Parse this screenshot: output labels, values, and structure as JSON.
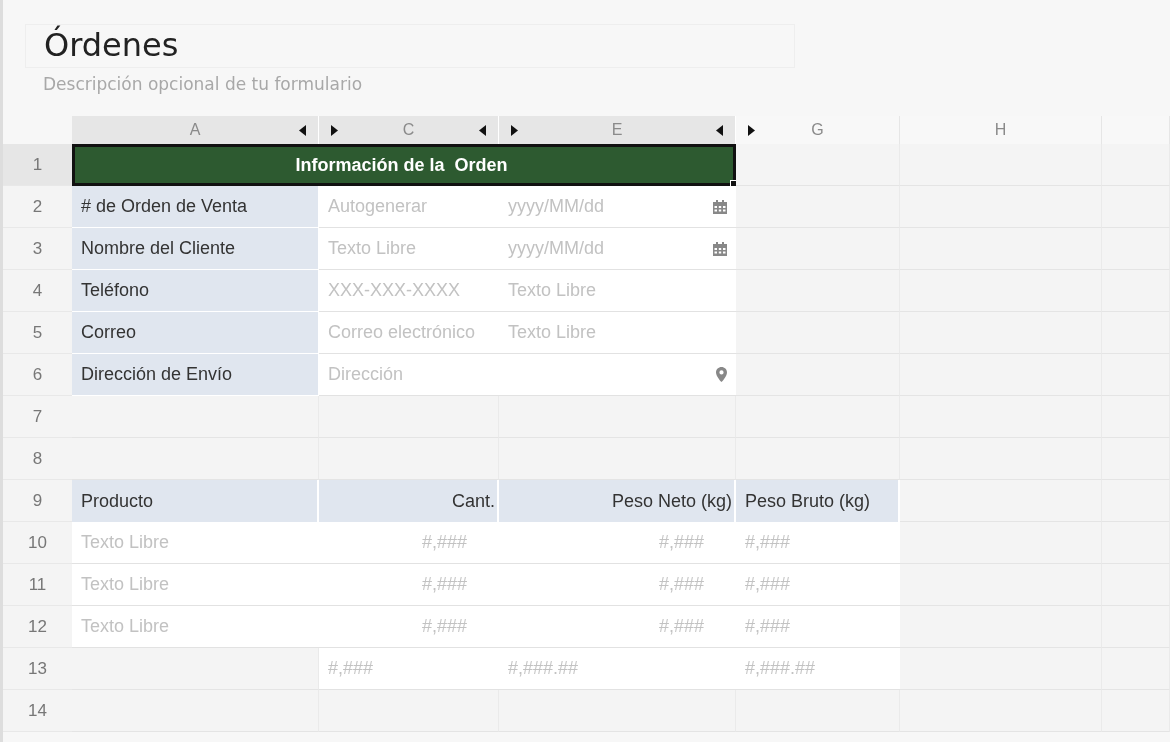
{
  "form": {
    "title": "Órdenes",
    "description": "Descripción opcional de tu formulario"
  },
  "columns": [
    {
      "letter": "A",
      "in_form": true,
      "hidden_before": false,
      "hidden_after": true
    },
    {
      "letter": "C",
      "in_form": true,
      "hidden_before": true,
      "hidden_after": true
    },
    {
      "letter": "E",
      "in_form": true,
      "hidden_before": true,
      "hidden_after": true
    },
    {
      "letter": "G",
      "in_form": false,
      "hidden_before": true,
      "hidden_after": false
    },
    {
      "letter": "H",
      "in_form": false,
      "hidden_before": false,
      "hidden_after": false
    }
  ],
  "rows": [
    {
      "number": "1",
      "cells": [
        {
          "kind": "title",
          "text": "Información de la  Orden",
          "selected": true
        }
      ]
    },
    {
      "number": "2",
      "cells": [
        {
          "kind": "label",
          "text": "# de Orden de Venta",
          "selected": false
        },
        {
          "kind": "text",
          "text": "Autogenerar",
          "selected": false
        },
        {
          "kind": "date",
          "text": "yyyy/MM/dd",
          "selected": false
        }
      ]
    },
    {
      "number": "3",
      "cells": [
        {
          "kind": "label",
          "text": "Nombre del Cliente",
          "selected": false
        },
        {
          "kind": "text",
          "text": "Texto Libre",
          "selected": false
        },
        {
          "kind": "date",
          "text": "yyyy/MM/dd",
          "selected": false
        }
      ]
    },
    {
      "number": "4",
      "cells": [
        {
          "kind": "label",
          "text": "Teléfono",
          "selected": false
        },
        {
          "kind": "text",
          "text": "XXX-XXX-XXXX",
          "selected": false
        },
        {
          "kind": "text",
          "text": "Texto Libre",
          "selected": false
        }
      ]
    },
    {
      "number": "5",
      "cells": [
        {
          "kind": "label",
          "text": "Correo",
          "selected": false
        },
        {
          "kind": "text",
          "text": "Correo electrónico",
          "selected": false
        },
        {
          "kind": "text",
          "text": "Texto Libre",
          "selected": false
        }
      ]
    },
    {
      "number": "6",
      "cells": [
        {
          "kind": "label",
          "text": "Dirección de Envío",
          "selected": false
        },
        {
          "kind": "address",
          "text": "Dirección",
          "selected": false
        }
      ]
    },
    {
      "number": "7"
    },
    {
      "number": "8"
    },
    {
      "number": "9",
      "cells": [
        {
          "kind": "header",
          "text": "Producto",
          "selected": false
        },
        {
          "kind": "header_number",
          "text": "Cant.",
          "selected": false
        },
        {
          "kind": "header_number",
          "text": "Peso Neto (kg)",
          "selected": false
        },
        {
          "kind": "header",
          "text": "Peso Bruto (kg)",
          "selected": false
        }
      ]
    },
    {
      "number": "10",
      "cells": [
        {
          "kind": "text",
          "text": "Texto Libre",
          "selected": false
        },
        {
          "kind": "number",
          "text": "#,###",
          "selected": false
        },
        {
          "kind": "number",
          "text": "#,###",
          "selected": false
        },
        {
          "kind": "text",
          "text": "#,###",
          "selected": false
        }
      ]
    },
    {
      "number": "11",
      "cells": [
        {
          "kind": "text",
          "text": "Texto Libre",
          "selected": false
        },
        {
          "kind": "number",
          "text": "#,###",
          "selected": false
        },
        {
          "kind": "number",
          "text": "#,###",
          "selected": false
        },
        {
          "kind": "text",
          "text": "#,###",
          "selected": false
        }
      ]
    },
    {
      "number": "12",
      "cells": [
        {
          "kind": "text",
          "text": "Texto Libre",
          "selected": false
        },
        {
          "kind": "number",
          "text": "#,###",
          "selected": false
        },
        {
          "kind": "number",
          "text": "#,###",
          "selected": false
        },
        {
          "kind": "text",
          "text": "#,###",
          "selected": false
        }
      ]
    },
    {
      "number": "13",
      "cells": [
        {
          "kind": "empty",
          "selected": false
        },
        {
          "kind": "text",
          "text": "#,###",
          "selected": false
        },
        {
          "kind": "text",
          "text": "#,###.##",
          "selected": false
        },
        {
          "kind": "text",
          "text": "#,###.##",
          "selected": false
        }
      ]
    },
    {
      "number": "14"
    }
  ]
}
